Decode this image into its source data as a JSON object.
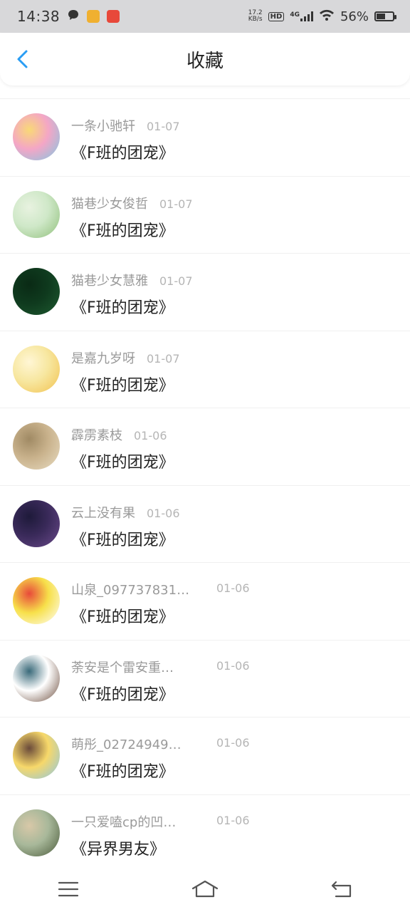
{
  "status_bar": {
    "time": "14:38",
    "net_speed_value": "17.2",
    "net_speed_unit": "KB/s",
    "hd": "HD",
    "network": "4G",
    "battery": "56%",
    "battery_level": 0.56
  },
  "header": {
    "title": "收藏"
  },
  "items": [
    {
      "user": "一条小驰轩",
      "date": "01-07",
      "title": "《F班的团宠》",
      "avatar_colors": [
        "#f4a6c6",
        "#7ec8e3",
        "#f9d976"
      ]
    },
    {
      "user": "猫巷少女俊哲",
      "date": "01-07",
      "title": "《F班的团宠》",
      "avatar_colors": [
        "#cfe8c8",
        "#8fbf7a",
        "#e8f2e0"
      ]
    },
    {
      "user": "猫巷少女慧雅",
      "date": "01-07",
      "title": "《F班的团宠》",
      "avatar_colors": [
        "#0f3a1e",
        "#1e5a30",
        "#0a2a15"
      ]
    },
    {
      "user": "是嘉九岁呀",
      "date": "01-07",
      "title": "《F班的团宠》",
      "avatar_colors": [
        "#f7e7a0",
        "#f2c14e",
        "#fff6d5"
      ]
    },
    {
      "user": "霹雳素枝",
      "date": "01-06",
      "title": "《F班的团宠》",
      "avatar_colors": [
        "#c9b28c",
        "#e8dcc2",
        "#a08a64"
      ]
    },
    {
      "user": "云上没有果",
      "date": "01-06",
      "title": "《F班的团宠》",
      "avatar_colors": [
        "#3a2a5a",
        "#6a4a8a",
        "#1e1a3a"
      ]
    },
    {
      "user": "山泉_097737831…",
      "date": "01-06",
      "title": "《F班的团宠》",
      "avatar_colors": [
        "#f7e04a",
        "#ffffff",
        "#e84a3a"
      ]
    },
    {
      "user": "荼安是个雷安重…",
      "date": "01-06",
      "title": "《F班的团宠》",
      "avatar_colors": [
        "#ffffff",
        "#6a4a3a",
        "#3a6a7a"
      ]
    },
    {
      "user": "萌彤_02724949…",
      "date": "01-06",
      "title": "《F班的团宠》",
      "avatar_colors": [
        "#f7d86a",
        "#8ac6e8",
        "#6a4a3a"
      ]
    },
    {
      "user": "一只爱嗑cp的凹…",
      "date": "01-06",
      "title": "《异界男友》",
      "avatar_colors": [
        "#a8b89a",
        "#4a5a3a",
        "#d8c8a8"
      ]
    }
  ]
}
